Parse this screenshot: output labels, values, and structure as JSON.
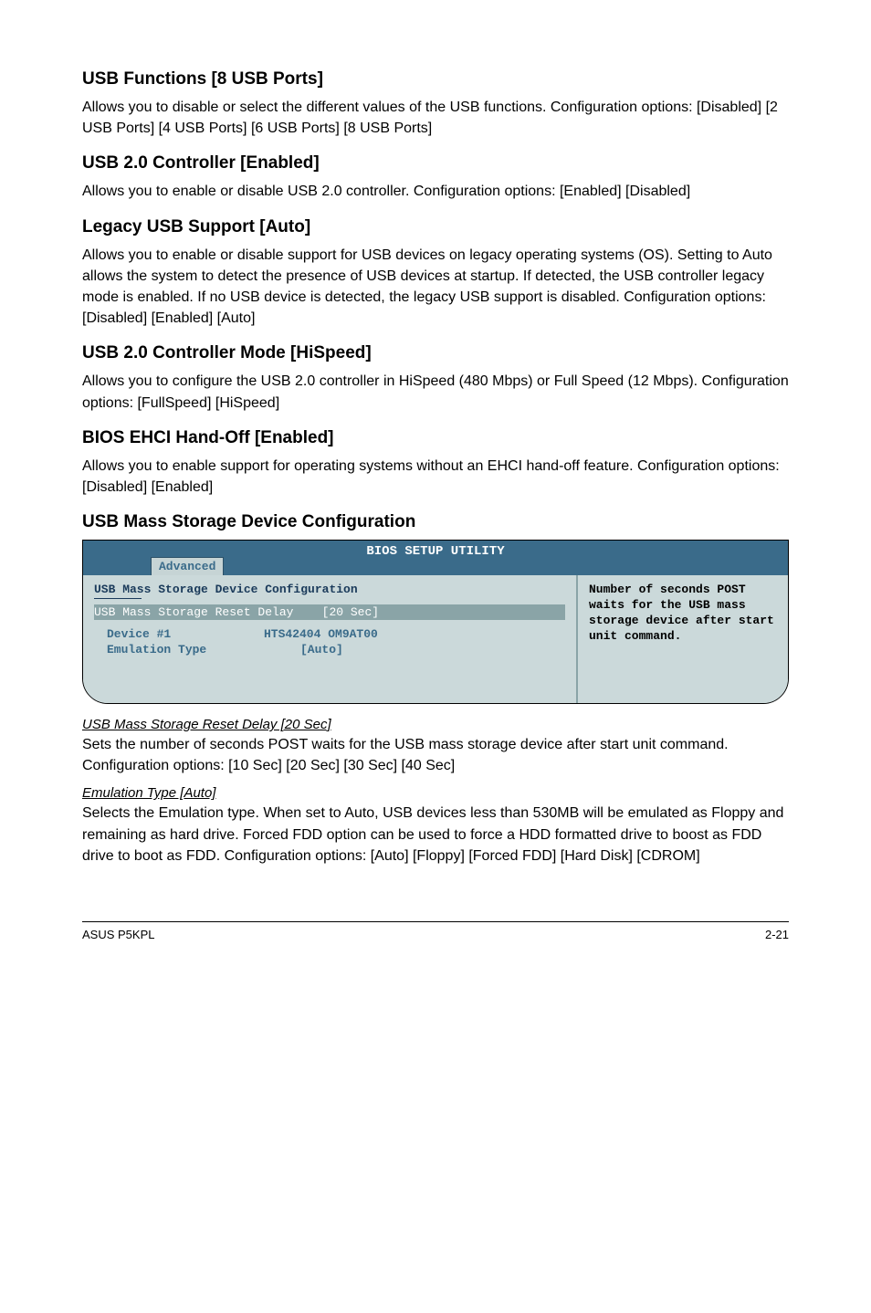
{
  "sections": {
    "usb_functions": {
      "title": "USB Functions [8 USB Ports]",
      "body": "Allows you to disable or select the different values of the USB functions. Configuration options: [Disabled] [2 USB Ports] [4 USB Ports] [6 USB Ports] [8 USB Ports]"
    },
    "usb20_controller": {
      "title": "USB 2.0 Controller [Enabled]",
      "body": "Allows you to enable or disable USB 2.0 controller. Configuration options: [Enabled] [Disabled]"
    },
    "legacy_usb": {
      "title": "Legacy USB Support [Auto]",
      "body": "Allows you to enable or disable support for USB devices on legacy operating systems (OS). Setting to Auto allows the system to detect the presence of USB devices at startup. If detected, the USB controller legacy mode is enabled. If no USB device is detected, the legacy USB support is disabled. Configuration options: [Disabled] [Enabled] [Auto]"
    },
    "usb20_mode": {
      "title": "USB 2.0 Controller Mode [HiSpeed]",
      "body": "Allows you to configure the USB 2.0 controller in HiSpeed (480 Mbps) or Full Speed (12 Mbps). Configuration options: [FullSpeed] [HiSpeed]"
    },
    "bios_ehci": {
      "title": "BIOS EHCI Hand-Off [Enabled]",
      "body": "Allows you to enable support for operating systems without an EHCI hand-off feature. Configuration options: [Disabled] [Enabled]"
    },
    "usb_mass": {
      "title": "USB Mass Storage Device Configuration"
    }
  },
  "bios": {
    "header_title": "BIOS SETUP UTILITY",
    "tab": "Advanced",
    "left_title": "USB Mass Storage Device Configuration",
    "selected_label": "USB Mass Storage Reset Delay",
    "selected_value": "[20 Sec]",
    "device_label": "Device #1",
    "device_value": "HTS42404 OM9AT00",
    "emu_label": "Emulation Type",
    "emu_value": "[Auto]",
    "help_text": "Number of seconds POST waits for the USB mass storage device after start unit command."
  },
  "sub": {
    "reset_delay": {
      "title": "USB Mass Storage Reset Delay [20 Sec]",
      "body": "Sets the number of seconds POST waits for the USB mass storage device after start unit command. Configuration options: [10 Sec] [20 Sec] [30 Sec] [40 Sec]"
    },
    "emulation": {
      "title": "Emulation Type [Auto]",
      "body": "Selects the Emulation type. When set to Auto, USB devices less than 530MB will be emulated as Floppy and remaining as hard drive. Forced FDD option can be used to force a HDD formatted drive to boost as FDD drive to boot as FDD. Configuration options: [Auto] [Floppy] [Forced FDD] [Hard Disk] [CDROM]"
    }
  },
  "footer": {
    "left": "ASUS P5KPL",
    "right": "2-21"
  }
}
